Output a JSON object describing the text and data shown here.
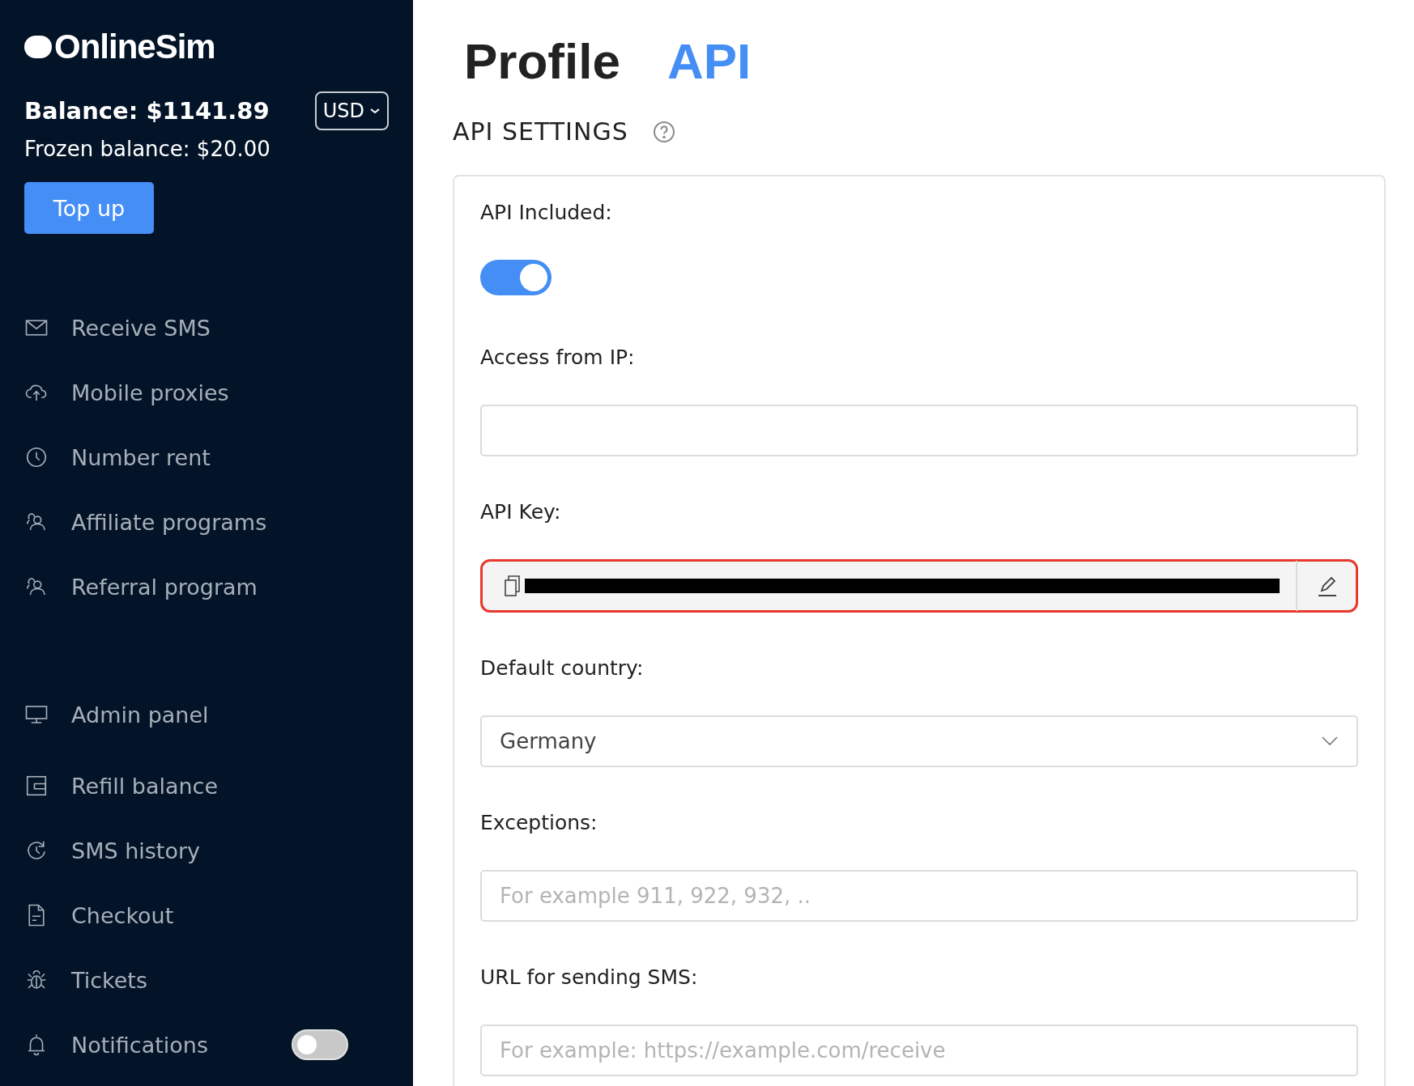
{
  "sidebar": {
    "logo": "OnlineSim",
    "balance": "Balance: $1141.89",
    "currency": "USD",
    "frozen_balance": "Frozen balance: $20.00",
    "top_up_button": "Top up",
    "nav_groups": [
      {
        "items": [
          {
            "label": "Receive SMS",
            "kind": "link"
          },
          {
            "label": "Mobile proxies",
            "kind": "link"
          },
          {
            "label": "Number rent",
            "kind": "link"
          },
          {
            "label": "Affiliate programs",
            "kind": "link"
          },
          {
            "label": "Referral program",
            "kind": "link"
          }
        ]
      },
      {
        "items": [
          {
            "label": "Admin panel",
            "kind": "link"
          },
          {
            "label": "Refill balance",
            "kind": "link"
          },
          {
            "label": "SMS history",
            "kind": "link"
          },
          {
            "label": "Checkout",
            "kind": "link"
          },
          {
            "label": "Tickets",
            "kind": "link"
          },
          {
            "label": "Notifications",
            "kind": "toggle",
            "on": false
          }
        ]
      }
    ]
  },
  "tabs": [
    {
      "label": "Profile",
      "selected": false
    },
    {
      "label": "API",
      "selected": true
    }
  ],
  "section_title": "API SETTINGS",
  "fields": [
    {
      "kind": "toggle",
      "label": "API Included:",
      "on": true
    },
    {
      "kind": "input",
      "label": "Access from IP:"
    },
    {
      "kind": "key",
      "label": "API Key:",
      "highlighted": true
    },
    {
      "kind": "select",
      "label": "Default country:",
      "value": "Germany"
    },
    {
      "kind": "input",
      "label": "Exceptions:",
      "placeholder": "For example 911, 922, 932, .."
    },
    {
      "kind": "input",
      "label": "URL for sending SMS:",
      "placeholder": "For example: https://example.com/receive"
    }
  ]
}
